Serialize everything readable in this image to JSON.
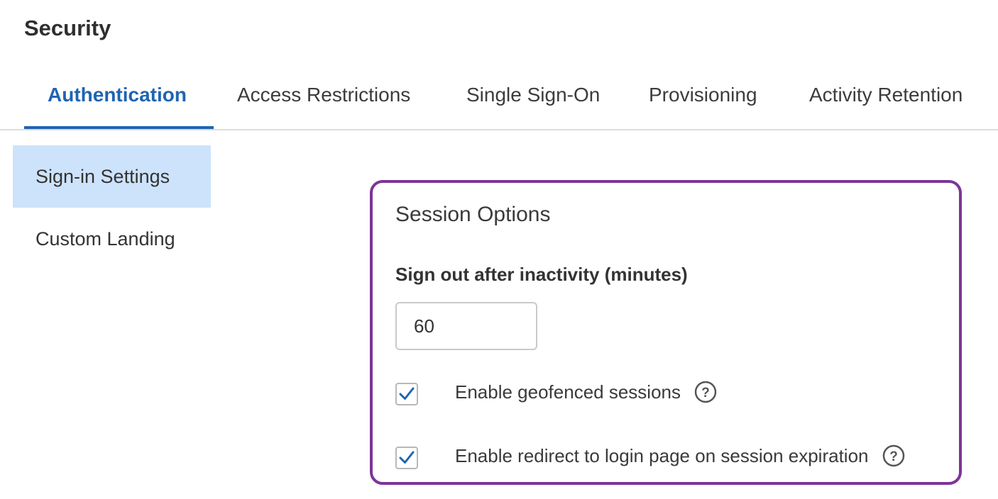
{
  "page": {
    "title": "Security"
  },
  "tabs": [
    {
      "label": "Authentication",
      "active": true
    },
    {
      "label": "Access Restrictions",
      "active": false
    },
    {
      "label": "Single Sign-On",
      "active": false
    },
    {
      "label": "Provisioning",
      "active": false
    },
    {
      "label": "Activity Retention",
      "active": false
    }
  ],
  "sidebar": {
    "items": [
      {
        "label": "Sign-in Settings",
        "active": true
      },
      {
        "label": "Custom Landing",
        "active": false
      }
    ]
  },
  "session_options": {
    "title": "Session Options",
    "inactivity_label": "Sign out after inactivity (minutes)",
    "inactivity_value": "60",
    "options": [
      {
        "label": "Enable geofenced sessions",
        "checked": true,
        "help_icon": "question-circle-icon"
      },
      {
        "label": "Enable redirect to login page on session expiration",
        "checked": true,
        "help_icon": "question-circle-icon"
      }
    ]
  },
  "colors": {
    "accent": "#1f64b2",
    "active_side_bg": "#cde3fb",
    "panel_border": "#7d3596",
    "check": "#1f64b2"
  }
}
